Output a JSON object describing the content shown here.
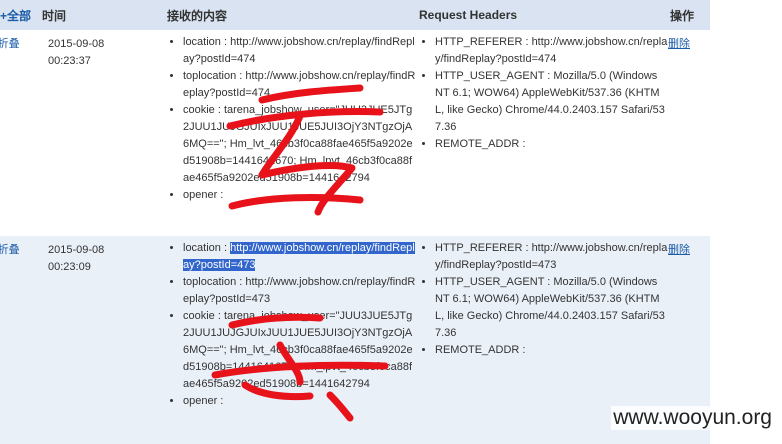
{
  "header": {
    "toggle_all": "+全部",
    "time": "时间",
    "content": "接收的内容",
    "request_headers": "Request Headers",
    "actions": "操作"
  },
  "rows": [
    {
      "toggle": "-折叠",
      "date": "2015-09-08",
      "time": "00:23:37",
      "content": [
        "location : http://www.jobshow.cn/replay/findReplay?postId=474",
        "toplocation : http://www.jobshow.cn/replay/findReplay?postId=474",
        "cookie : tarena_jobshow_user=\"JUU3JUE5JTg2JUU1JUJGJUIxJUU1JUE5JUI3OjY3NTgzOjA6MQ==\"; Hm_lvt_46cb3f0ca88fae465f5a9202ed51908b=1441641670; Hm_lpvt_46cb3f0ca88fae465f5a9202ed51908b=1441642794",
        "opener :"
      ],
      "headers": [
        "HTTP_REFERER : http://www.jobshow.cn/replay/findReplay?postId=474",
        "HTTP_USER_AGENT : Mozilla/5.0 (Windows NT 6.1; WOW64) AppleWebKit/537.36 (KHTML, like Gecko) Chrome/44.0.2403.157 Safari/537.36",
        "REMOTE_ADDR :"
      ],
      "delete": "删除"
    },
    {
      "toggle": "-折叠",
      "date": "2015-09-08",
      "time": "00:23:09",
      "content": [
        "location : http://www.jobshow.cn/replay/findReplay?postId=473",
        "toplocation : http://www.jobshow.cn/replay/findReplay?postId=473",
        "cookie : tarena_jobshow_user=\"JUU3JUE5JTg2JUU1JUJGJUIxJUU1JUE5JUI3OjY3NTgzOjA6MQ==\"; Hm_lvt_46cb3f0ca88fae465f5a9202ed51908b=1441641670; Hm_lpvt_46cb3f0ca88fae465f5a9202ed51908b=1441642794",
        "opener :"
      ],
      "headers": [
        "HTTP_REFERER : http://www.jobshow.cn/replay/findReplay?postId=473",
        "HTTP_USER_AGENT : Mozilla/5.0 (Windows NT 6.1; WOW64) AppleWebKit/537.36 (KHTML, like Gecko) Chrome/44.0.2403.157 Safari/537.36",
        "REMOTE_ADDR :"
      ],
      "delete": "删除",
      "selection": {
        "prefix": "location : ",
        "selected_text": "http://www.jobshow.cn/replay/findReplay?postId=473"
      }
    }
  ],
  "annotation_colors": {
    "scribble": "#e8121a",
    "selection": "#3366cc"
  },
  "watermark": "www.wooyun.org"
}
